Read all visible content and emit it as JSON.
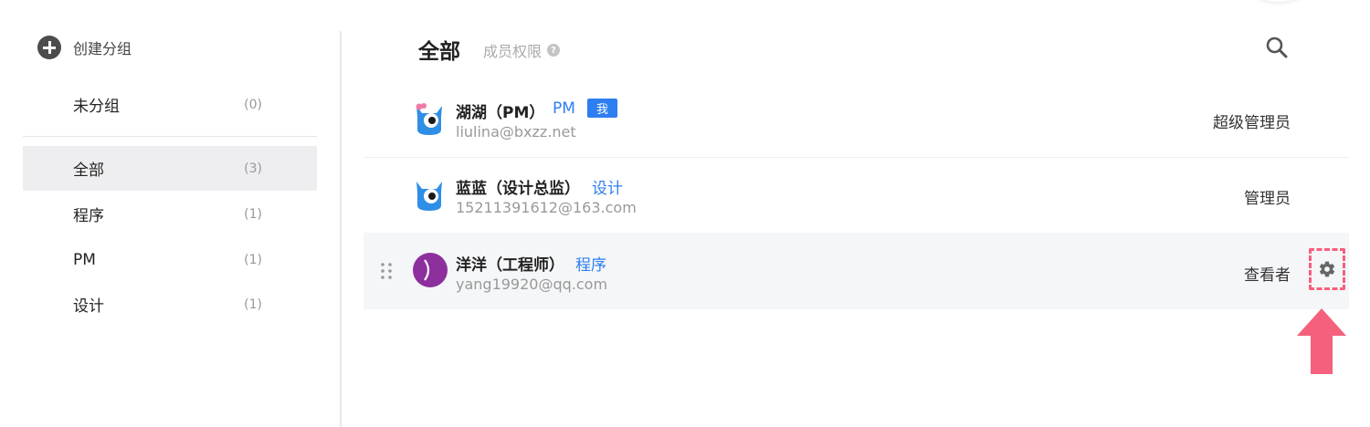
{
  "sidebar": {
    "create_group_label": "创建分组",
    "ungrouped": {
      "label": "未分组",
      "count": "(0)"
    },
    "groups": [
      {
        "label": "全部",
        "count": "(3)",
        "active": true
      },
      {
        "label": "程序",
        "count": "(1)"
      },
      {
        "label": "PM",
        "count": "(1)"
      },
      {
        "label": "设计",
        "count": "(1)"
      }
    ]
  },
  "header": {
    "title": "全部",
    "permissions_label": "成员权限",
    "help_icon": "?",
    "search_icon": "search-icon"
  },
  "members": [
    {
      "name": "湖湖（PM）",
      "tag": "PM",
      "badge": "我",
      "email": "liulina@bxzz.net",
      "role": "超级管理员",
      "avatar": "blue-monster-with-bow"
    },
    {
      "name": "蓝蓝（设计总监）",
      "tag": "设计",
      "email": "15211391612@163.com",
      "role": "管理员",
      "avatar": "blue-monster"
    },
    {
      "name": "洋洋（工程师）",
      "tag": "程序",
      "email": "yang19920@qq.com",
      "role": "查看者",
      "avatar": "purple-ball"
    }
  ],
  "colors": {
    "accent": "#2d7ef0",
    "highlight": "#f5607d",
    "avatar_blue": "#2f8ee6",
    "avatar_purple": "#8e2f9e"
  }
}
